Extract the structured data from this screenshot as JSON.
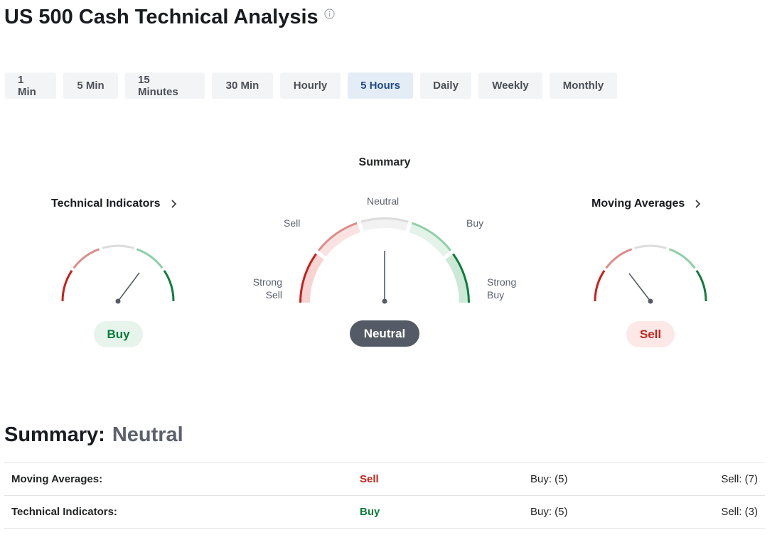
{
  "page": {
    "title": "US 500 Cash Technical Analysis"
  },
  "tabs": [
    {
      "label": "1 Min",
      "active": false
    },
    {
      "label": "5 Min",
      "active": false
    },
    {
      "label": "15 Minutes",
      "active": false
    },
    {
      "label": "30 Min",
      "active": false
    },
    {
      "label": "Hourly",
      "active": false
    },
    {
      "label": "5 Hours",
      "active": true
    },
    {
      "label": "Daily",
      "active": false
    },
    {
      "label": "Weekly",
      "active": false
    },
    {
      "label": "Monthly",
      "active": false
    }
  ],
  "gauges": {
    "summary": {
      "heading": "Summary",
      "labels": {
        "strong_sell": "Strong\nSell",
        "sell": "Sell",
        "neutral": "Neutral",
        "buy": "Buy",
        "strong_buy": "Strong\nBuy"
      },
      "result": "Neutral",
      "needle_position": "neutral"
    },
    "technical_indicators": {
      "heading": "Technical Indicators",
      "result": "Buy",
      "needle_position": "buy"
    },
    "moving_averages": {
      "heading": "Moving Averages",
      "result": "Sell",
      "needle_position": "sell"
    }
  },
  "summary": {
    "label": "Summary:",
    "value": "Neutral",
    "rows": [
      {
        "name": "Moving Averages:",
        "signal": "Sell",
        "signal_class": "sell",
        "buy": "Buy: (5)",
        "sell": "Sell: (7)"
      },
      {
        "name": "Technical Indicators:",
        "signal": "Buy",
        "signal_class": "buy",
        "buy": "Buy: (5)",
        "sell": "Sell: (3)"
      }
    ]
  },
  "colors": {
    "strong_sell": "#c8201a",
    "sell": "#dd8c8a",
    "neutral": "#dcdcdc",
    "buy": "#8fcfa6",
    "strong_buy": "#0f7d3c",
    "active_tab": "#1f4a8a",
    "needle": "#545a66"
  },
  "icons": {
    "info": "info-icon",
    "chevron": "chevron-right-icon"
  }
}
